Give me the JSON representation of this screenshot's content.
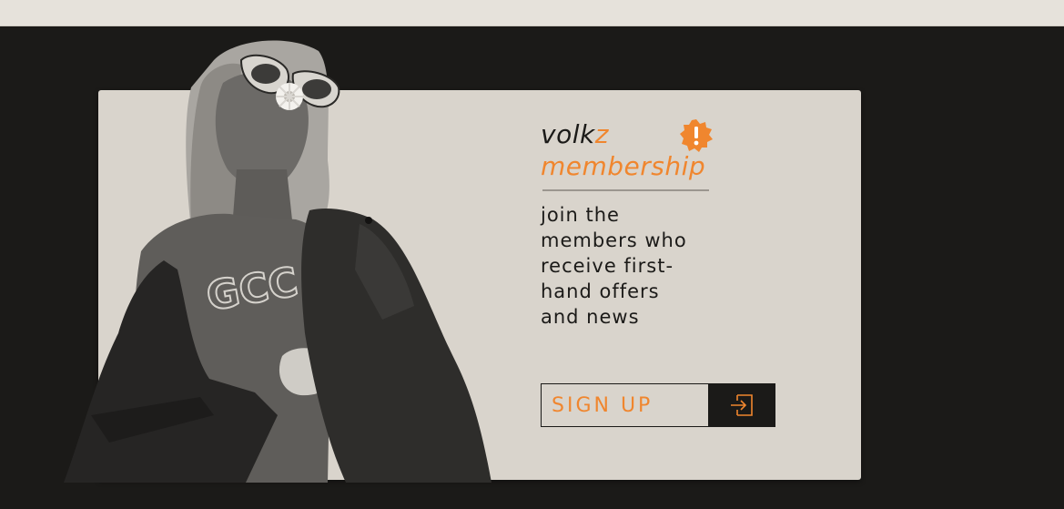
{
  "brand": {
    "name_main": "volk",
    "name_accent": "z",
    "subtitle": "membership"
  },
  "tagline": {
    "lines": [
      "join the",
      "members who",
      "receive first-",
      "hand offers",
      "and news"
    ]
  },
  "cta": {
    "signup_label": "SIGN UP",
    "signup_icon": "login-arrow-icon"
  },
  "badge": {
    "icon": "alert-badge-icon",
    "glyph": "!"
  },
  "colors": {
    "background": "#1b1a18",
    "card": "#d9d4cc",
    "accent": "#f0862e",
    "topbar": "#e6e2db"
  }
}
